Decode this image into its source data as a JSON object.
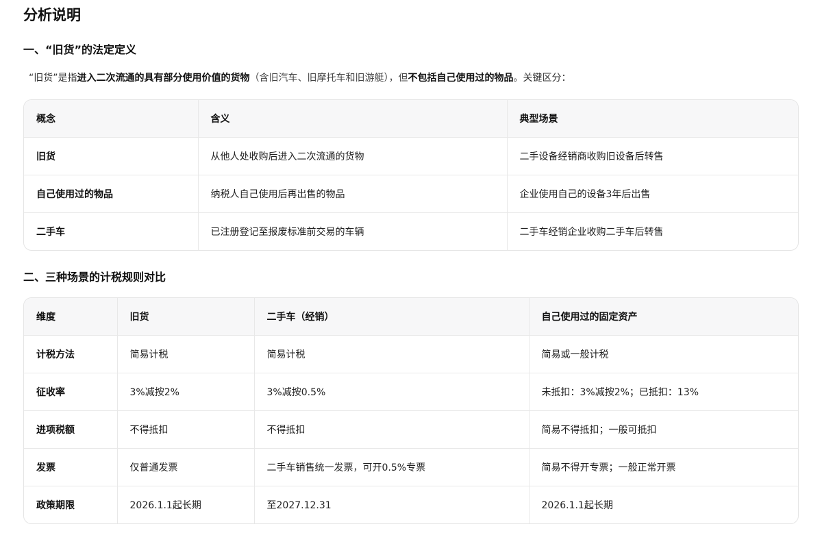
{
  "title": "分析说明",
  "section1": {
    "heading": "一、“旧货”的法定定义",
    "intro": {
      "p1": "“旧货”是指",
      "b1": "进入二次流通的具有部分使用价值的货物",
      "p2": "（含旧汽车、旧摩托车和旧游艇），但",
      "b2": "不包括自己使用过的物品",
      "p3": "。关键区分："
    },
    "table": {
      "headers": [
        "概念",
        "含义",
        "典型场景"
      ],
      "rows": [
        [
          "旧货",
          "从他人处收购后进入二次流通的货物",
          "二手设备经销商收购旧设备后转售"
        ],
        [
          "自己使用过的物品",
          "纳税人自己使用后再出售的物品",
          "企业使用自己的设备3年后出售"
        ],
        [
          "二手车",
          "已注册登记至报废标准前交易的车辆",
          "二手车经销企业收购二手车后转售"
        ]
      ]
    }
  },
  "section2": {
    "heading": "二、三种场景的计税规则对比",
    "table": {
      "headers": [
        "维度",
        "旧货",
        "二手车（经销）",
        "自己使用过的固定资产"
      ],
      "rows": [
        [
          "计税方法",
          "简易计税",
          "简易计税",
          "简易或一般计税"
        ],
        [
          "征收率",
          "3%减按2%",
          "3%减按0.5%",
          "未抵扣：3%减按2%；已抵扣：13%"
        ],
        [
          "进项税额",
          "不得抵扣",
          "不得抵扣",
          "简易不得抵扣；一般可抵扣"
        ],
        [
          "发票",
          "仅普通发票",
          "二手车销售统一发票，可开0.5%专票",
          "简易不得开专票；一般正常开票"
        ],
        [
          "政策期限",
          "2026.1.1起长期",
          "至2027.12.31",
          "2026.1.1起长期"
        ]
      ]
    }
  }
}
